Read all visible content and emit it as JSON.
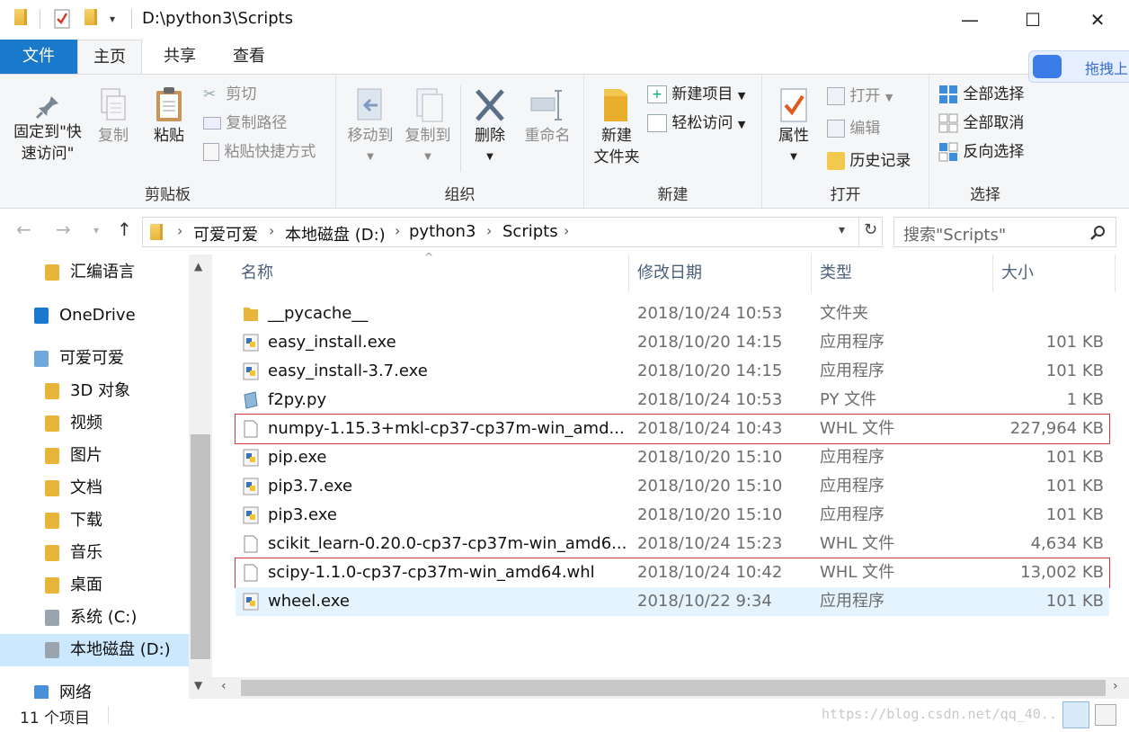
{
  "window": {
    "title": "D:\\python3\\Scripts",
    "controls": {
      "minimize": "—",
      "maximize": "☐",
      "close": "✕"
    }
  },
  "ribbon_tabs": [
    "文件",
    "主页",
    "共享",
    "查看"
  ],
  "ribbon": {
    "clipboard": {
      "label": "剪贴板",
      "pin": "固定到\"快速访问\"",
      "pin_line1": "固定到\"快",
      "pin_line2": "速访问\"",
      "copy": "复制",
      "paste": "粘贴",
      "cut": "剪切",
      "copy_path": "复制路径",
      "paste_shortcut": "粘贴快捷方式"
    },
    "organize": {
      "label": "组织",
      "move_to": "移动到",
      "copy_to": "复制到",
      "delete": "删除",
      "rename": "重命名"
    },
    "new": {
      "label": "新建",
      "new_folder_line1": "新建",
      "new_folder_line2": "文件夹",
      "new_item": "新建项目",
      "easy_access": "轻松访问"
    },
    "open": {
      "label": "打开",
      "properties": "属性",
      "open": "打开",
      "edit": "编辑",
      "history": "历史记录"
    },
    "select": {
      "label": "选择",
      "select_all": "全部选择",
      "select_none": "全部取消",
      "invert": "反向选择"
    }
  },
  "overlay": {
    "baidu_label": "拖拽上"
  },
  "address": {
    "crumbs": [
      "可爱可爱",
      "本地磁盘 (D:)",
      "python3",
      "Scripts"
    ],
    "search_placeholder": "搜索\"Scripts\""
  },
  "nav_pane": [
    {
      "label": "汇编语言",
      "icon": "folder-icon"
    },
    {
      "label": "OneDrive",
      "icon": "onedrive-icon"
    },
    {
      "label": "可爱可爱",
      "icon": "computer-icon"
    },
    {
      "label": "3D 对象",
      "icon": "folder-3d-icon"
    },
    {
      "label": "视频",
      "icon": "video-folder-icon"
    },
    {
      "label": "图片",
      "icon": "pictures-folder-icon"
    },
    {
      "label": "文档",
      "icon": "documents-folder-icon"
    },
    {
      "label": "下载",
      "icon": "downloads-folder-icon"
    },
    {
      "label": "音乐",
      "icon": "music-folder-icon"
    },
    {
      "label": "桌面",
      "icon": "desktop-folder-icon"
    },
    {
      "label": "系统 (C:)",
      "icon": "drive-icon"
    },
    {
      "label": "本地磁盘 (D:)",
      "icon": "drive-icon",
      "selected": true
    },
    {
      "label": "网络",
      "icon": "network-icon"
    }
  ],
  "columns": {
    "name": "名称",
    "date": "修改日期",
    "type": "类型",
    "size": "大小"
  },
  "files": [
    {
      "name": "__pycache__",
      "date": "2018/10/24 10:53",
      "type": "文件夹",
      "size": "",
      "icon": "folder-icon"
    },
    {
      "name": "easy_install.exe",
      "date": "2018/10/20 14:15",
      "type": "应用程序",
      "size": "101 KB",
      "icon": "python-exe-icon"
    },
    {
      "name": "easy_install-3.7.exe",
      "date": "2018/10/20 14:15",
      "type": "应用程序",
      "size": "101 KB",
      "icon": "python-exe-icon"
    },
    {
      "name": "f2py.py",
      "date": "2018/10/24 10:53",
      "type": "PY 文件",
      "size": "1 KB",
      "icon": "python-file-icon"
    },
    {
      "name": "numpy-1.15.3+mkl-cp37-cp37m-win_amd...",
      "date": "2018/10/24 10:43",
      "type": "WHL 文件",
      "size": "227,964 KB",
      "icon": "file-icon",
      "highlighted": true
    },
    {
      "name": "pip.exe",
      "date": "2018/10/20 15:10",
      "type": "应用程序",
      "size": "101 KB",
      "icon": "python-exe-icon"
    },
    {
      "name": "pip3.7.exe",
      "date": "2018/10/20 15:10",
      "type": "应用程序",
      "size": "101 KB",
      "icon": "python-exe-icon"
    },
    {
      "name": "pip3.exe",
      "date": "2018/10/20 15:10",
      "type": "应用程序",
      "size": "101 KB",
      "icon": "python-exe-icon"
    },
    {
      "name": "scikit_learn-0.20.0-cp37-cp37m-win_amd6...",
      "date": "2018/10/24 15:23",
      "type": "WHL 文件",
      "size": "4,634 KB",
      "icon": "file-icon"
    },
    {
      "name": "scipy-1.1.0-cp37-cp37m-win_amd64.whl",
      "date": "2018/10/24 10:42",
      "type": "WHL 文件",
      "size": "13,002 KB",
      "icon": "file-icon",
      "highlighted": true
    },
    {
      "name": "wheel.exe",
      "date": "2018/10/22 9:34",
      "type": "应用程序",
      "size": "101 KB",
      "icon": "python-exe-icon",
      "selected": true
    }
  ],
  "status": {
    "count": "11 个项目"
  },
  "watermark": "https://blog.csdn.net/qq_40..."
}
